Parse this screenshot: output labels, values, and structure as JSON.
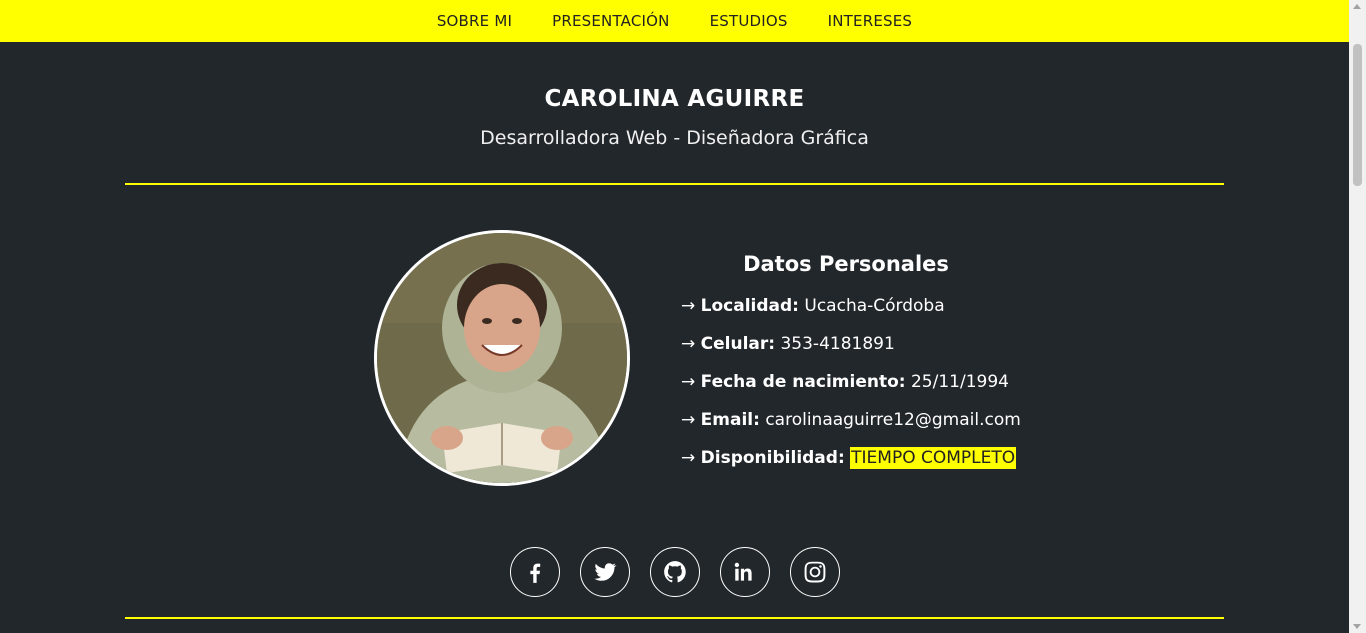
{
  "nav": {
    "items": [
      {
        "label": "SOBRE MI"
      },
      {
        "label": "PRESENTACIÓN"
      },
      {
        "label": "ESTUDIOS"
      },
      {
        "label": "INTERESES"
      }
    ]
  },
  "header": {
    "name": "CAROLINA AGUIRRE",
    "subtitle": "Desarrolladora Web - Diseñadora Gráfica"
  },
  "info": {
    "title": "Datos Personales",
    "arrow": "→",
    "rows": [
      {
        "key": "Localidad:",
        "value": "Ucacha-Córdoba"
      },
      {
        "key": "Celular:",
        "value": "353-4181891"
      },
      {
        "key": "Fecha de nacimiento:",
        "value": "25/11/1994"
      },
      {
        "key": "Email:",
        "value": "carolinaaguirre12@gmail.com"
      },
      {
        "key": "Disponibilidad:",
        "value": "TIEMPO COMPLETO"
      }
    ]
  },
  "socials": [
    {
      "icon": "facebook-icon"
    },
    {
      "icon": "twitter-icon"
    },
    {
      "icon": "github-icon"
    },
    {
      "icon": "linkedin-icon"
    },
    {
      "icon": "instagram-icon"
    }
  ],
  "colors": {
    "accent": "#ffff00",
    "background": "#22272b",
    "text": "#ffffff"
  }
}
